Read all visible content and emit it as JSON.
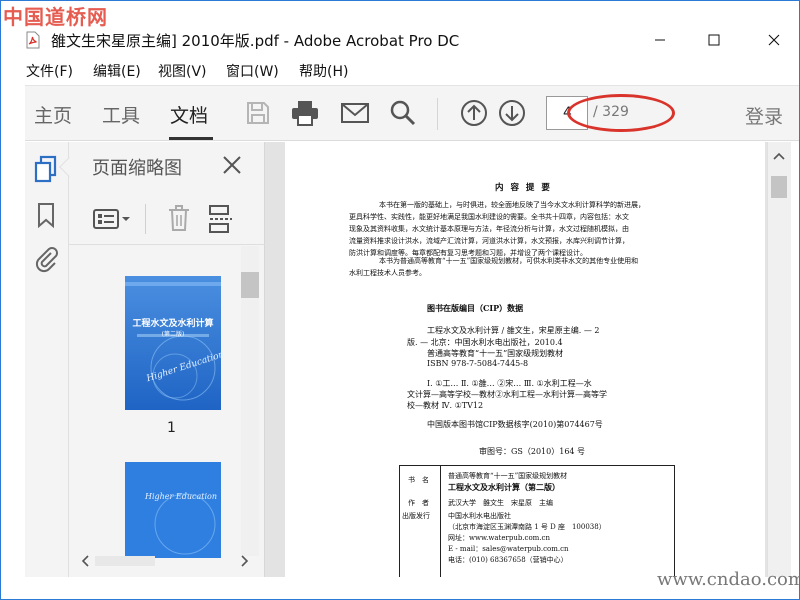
{
  "watermarks": {
    "top": "中国道桥网",
    "bottom": "www.cndao.com"
  },
  "titlebar": {
    "title": "雒文生宋星原主编] 2010年版.pdf - Adobe Acrobat Pro DC"
  },
  "menu": {
    "items": [
      "文件(F)",
      "编辑(E)",
      "视图(V)",
      "窗口(W)",
      "帮助(H)"
    ]
  },
  "toolbar": {
    "tabs": [
      "主页",
      "工具",
      "文档"
    ],
    "active_tab": "文档",
    "current_page": "4",
    "page_total": "/ 329",
    "login": "登录"
  },
  "thumbnails": {
    "title": "页面缩略图",
    "page_labels": [
      "1"
    ],
    "cover1": {
      "title": "工程水文及水利计算",
      "edition": "(第二版)",
      "series": "Higher Education"
    },
    "cover2": {
      "series": "Higher Education"
    }
  },
  "document": {
    "heading": "内 容 提 要",
    "abstract": [
      "本书在第一版的基础上，与时俱进，较全面地反映了当今水文水利计算科学的新进展，",
      "更具科学性、实践性，能更好地满足我国水利建设的需要。全书共十四章，内容包括：水文",
      "现象及其资料收集，水文统计基本原理与方法，年径流分析与计算，水文过程随机模拟，由",
      "流量资料推求设计洪水，流域产汇流计算，河道洪水计算，水文预报，水库兴利调节计算，",
      "防洪计算和调度等。每章都配有复习思考题和习题，并增设了两个课程设计。",
      "本书为普通高等教育“十一五”国家级规划教材，可供水利类非水文的其他专业使用和",
      "水利工程技术人员参考。"
    ],
    "cip_heading": "图书在版编目（CIP）数据",
    "cip_lines": [
      "工程水文及水利计算 / 雒文生，宋星原主编. — 2",
      "版. — 北京：中国水利水电出版社，2010.4",
      "普通高等教育“十一五”国家级规划教材",
      "ISBN 978-7-5084-7445-8"
    ],
    "cip_class_lines": [
      "Ⅰ. ①工… Ⅱ. ①雒… ②宋… Ⅲ. ①水利工程—水",
      "文计算—高等学校—教材②水利工程—水利计算—高等学",
      "校—教材 Ⅳ. ①TV12"
    ],
    "cip_number": "中国版本图书馆CIP数据核字(2010)第074467号",
    "review_number": "审图号：GS（2010）164 号",
    "table": {
      "rows": [
        {
          "label": "书　名",
          "values": [
            "普通高等教育“十一五”国家级规划教材",
            "工程水文及水利计算（第二版）"
          ]
        },
        {
          "label": "作　者",
          "values": [
            "武汉大学　雒文生　宋星原　主编"
          ]
        },
        {
          "label": "出版发行",
          "values": [
            "中国水利水电出版社",
            "（北京市海淀区玉渊潭南路 1 号 D 座　100038）",
            "网址：www.waterpub.com.cn",
            "E - mail：sales@waterpub.com.cn",
            "电话：(010) 68367658（营销中心）"
          ]
        }
      ]
    }
  }
}
